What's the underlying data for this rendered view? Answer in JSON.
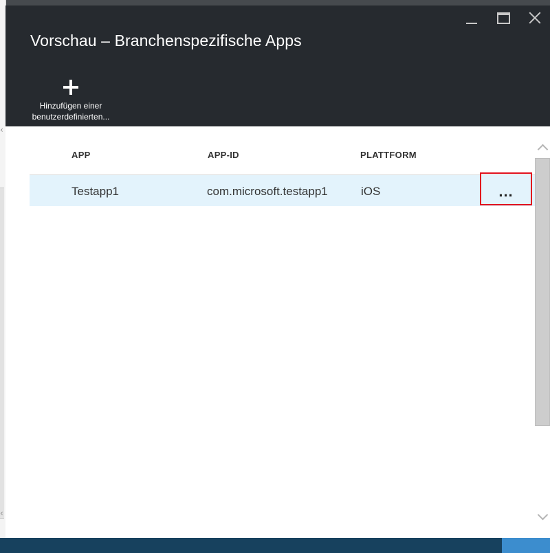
{
  "window": {
    "title": "Vorschau – Branchenspezifische Apps",
    "controls": {
      "minimize_icon": "minimize-icon",
      "maximize_icon": "maximize-icon",
      "close_icon": "close-icon"
    }
  },
  "commands": [
    {
      "icon": "plus-icon",
      "label": "Hinzufügen einer\nbenutzerdefinierten..."
    }
  ],
  "grid": {
    "columns": [
      "APP",
      "APP-ID",
      "PLATTFORM"
    ],
    "rows": [
      {
        "app": "Testapp1",
        "app_id": "com.microsoft.testapp1",
        "platform": "iOS",
        "more": "..."
      }
    ]
  },
  "colors": {
    "header_bg": "#262a2f",
    "selected_row": "#e3f3fc",
    "highlight_border": "#e1111e",
    "bottom_bar": "#17415e",
    "bottom_accent": "#3c8dce"
  }
}
